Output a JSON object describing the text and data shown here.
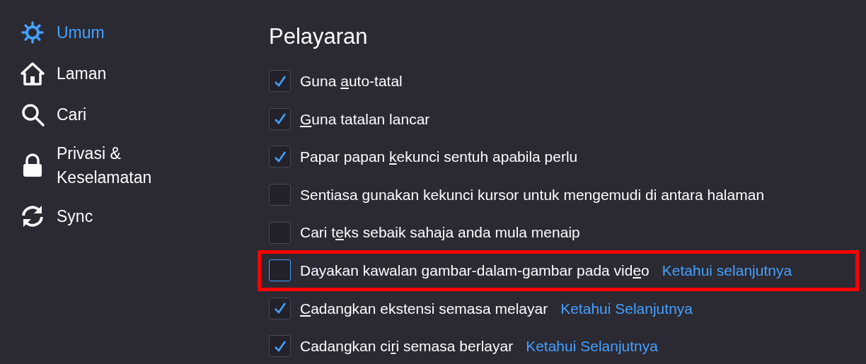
{
  "sidebar": {
    "items": [
      {
        "kind": "gear",
        "label": "Umum",
        "selected": true
      },
      {
        "kind": "home",
        "label": "Laman",
        "selected": false
      },
      {
        "kind": "search",
        "label": "Cari",
        "selected": false
      },
      {
        "kind": "lock",
        "label": "Privasi & Keselamatan",
        "selected": false
      },
      {
        "kind": "sync",
        "label": "Sync",
        "selected": false
      }
    ]
  },
  "section": {
    "title": "Pelayaran",
    "options": [
      {
        "before": "Guna ",
        "access_key": "a",
        "after": "uto-tatal",
        "checked": true,
        "highlighted": false
      },
      {
        "access_key": "G",
        "after": "una tatalan lancar",
        "checked": true,
        "highlighted": false
      },
      {
        "before": "Papar papan ",
        "access_key": "k",
        "after": "ekunci sentuh apabila perlu",
        "checked": true,
        "highlighted": false
      },
      {
        "before": "Sentiasa gunakan kekunci kursor untuk mengemudi di antara halaman",
        "checked": false,
        "highlighted": false
      },
      {
        "before": "Cari t",
        "access_key": "e",
        "after": "ks sebaik sahaja anda mula menaip",
        "checked": false,
        "highlighted": false
      },
      {
        "before": "Dayakan kawalan gambar-dalam-gambar pada vid",
        "access_key": "e",
        "after": "o",
        "checked": false,
        "highlighted": true,
        "link": "Ketahui selanjutnya"
      },
      {
        "access_key": "C",
        "after": "adangkan ekstensi semasa melayar",
        "checked": true,
        "highlighted": false,
        "link": "Ketahui Selanjutnya"
      },
      {
        "before": "Cadangkan ci",
        "access_key": "r",
        "after": "i semasa berlayar",
        "checked": true,
        "highlighted": false,
        "link": "Ketahui Selanjutnya"
      }
    ]
  }
}
